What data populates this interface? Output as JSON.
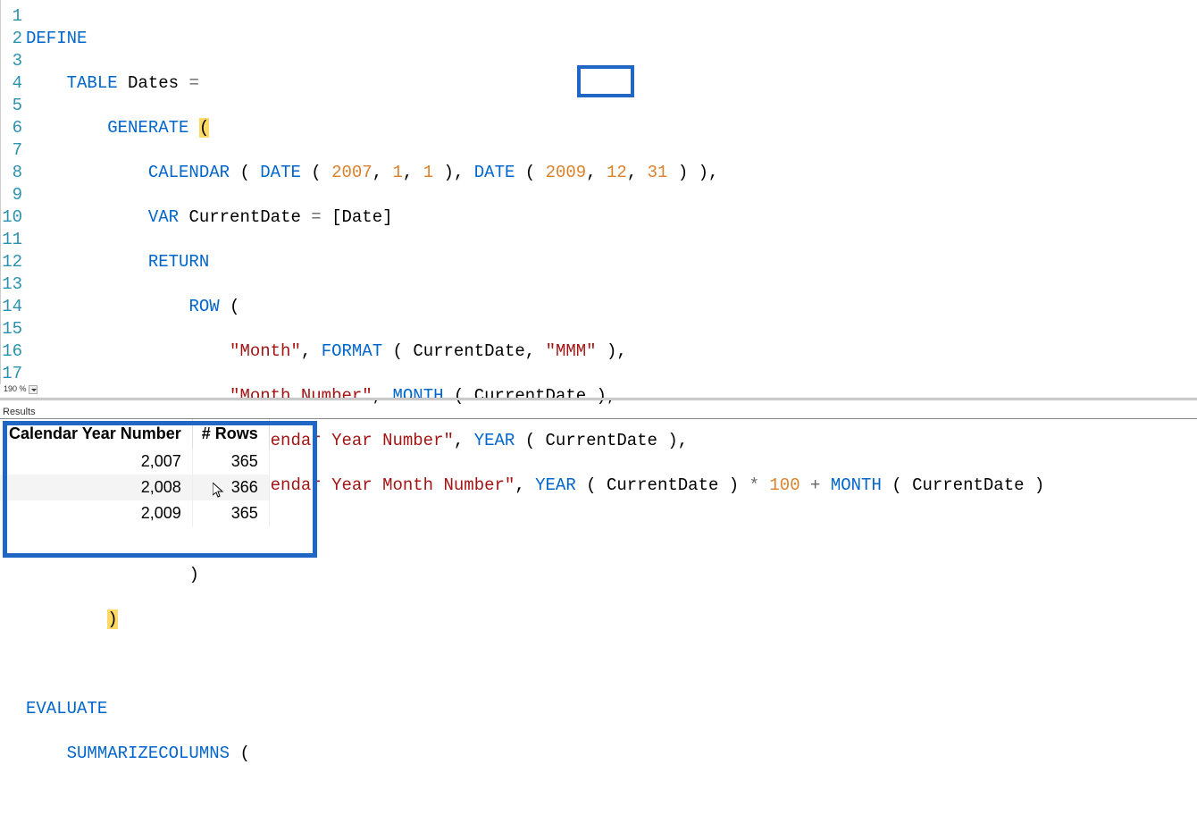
{
  "zoom": "190 %",
  "results_label": "Results",
  "code": {
    "lines": 17,
    "l1": {
      "define": "DEFINE"
    },
    "l2": {
      "table": "TABLE",
      "name": " Dates ",
      "eq": "="
    },
    "l3": {
      "generate": "GENERATE",
      "sp": " ",
      "lp": "("
    },
    "l4": {
      "calendar": "CALENDAR",
      "lp": " ( ",
      "date1": "DATE",
      "d1p": " ( ",
      "y1": "2007",
      "c": ", ",
      "m1": "1",
      "d1": "1",
      "rp1": " )",
      "ca": ", ",
      "date2": "DATE",
      "d2p": " ( ",
      "y2": "2009",
      "c2": ", ",
      "m2": "12",
      "d2": "31",
      "rp2": " ) ),"
    },
    "l5": {
      "var": "VAR",
      "name": " CurrentDate ",
      "eq": "= ",
      "ref": "[Date]"
    },
    "l6": {
      "return": "RETURN"
    },
    "l7": {
      "row": "ROW",
      "lp": " ("
    },
    "l8": {
      "s": "\"Month\"",
      "c": ", ",
      "fn": "FORMAT",
      "lp": " ( ",
      "arg": "CurrentDate",
      "c2": ", ",
      "fmt": "\"MMM\"",
      "rp": " ),"
    },
    "l9": {
      "s": "\"Month Number\"",
      "c": ", ",
      "fn": "MONTH",
      "lp": " ( ",
      "arg": "CurrentDate",
      "rp": " ),"
    },
    "l10": {
      "s": "\"Calendar Year Number\"",
      "c": ", ",
      "fn": "YEAR",
      "lp": " ( ",
      "arg": "CurrentDate",
      "rp": " ),"
    },
    "l11": {
      "s": "\"Calendar Year Month Number\"",
      "c": ", ",
      "fn": "YEAR",
      "lp": " ( ",
      "arg": "CurrentDate",
      "rp": " ) ",
      "op": "* ",
      "n": "100",
      "op2": " + ",
      "fn2": "MONTH",
      "lp2": " ( ",
      "arg2": "CurrentDate",
      "rp2": " )"
    },
    "l13": {
      "rp": ")"
    },
    "l14": {
      "rp": ")"
    },
    "l16": {
      "evaluate": "EVALUATE"
    },
    "l17": {
      "fn": "SUMMARIZECOLUMNS",
      "lp": " ("
    }
  },
  "results": {
    "headers": [
      "Calendar Year Number",
      "# Rows"
    ],
    "rows": [
      {
        "year": "2,007",
        "rows": "365"
      },
      {
        "year": "2,008",
        "rows": "366"
      },
      {
        "year": "2,009",
        "rows": "365"
      }
    ]
  }
}
